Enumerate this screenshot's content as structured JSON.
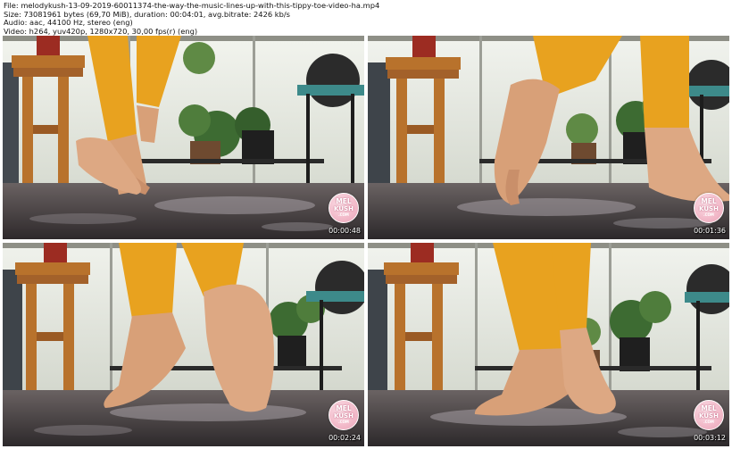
{
  "header": {
    "file": "File: melodykush-13-09-2019-60011374-the-way-the-music-lines-up-with-this-tippy-toe-video-ha.mp4",
    "size": "Size: 73081961 bytes (69,70 MiB), duration: 00:04:01, avg.bitrate: 2426 kb/s",
    "audio": "Audio: aac, 44100 Hz, stereo (eng)",
    "video": "Video: h264, yuv420p, 1280x720, 30,00 fps(r) (eng)"
  },
  "watermark": {
    "line1": "MEL",
    "line2": "KUSH",
    "line3": ".COM"
  },
  "thumbnails": [
    {
      "timestamp": "00:00:48"
    },
    {
      "timestamp": "00:01:36"
    },
    {
      "timestamp": "00:02:24"
    },
    {
      "timestamp": "00:03:12"
    }
  ],
  "colors": {
    "leggings": "#e8a21f",
    "skin": "#d8a078",
    "floor": "#4a4446",
    "wood_stool": "#b8722c",
    "plants": "#3d6b32",
    "logo_pink": "#f3bccb"
  }
}
